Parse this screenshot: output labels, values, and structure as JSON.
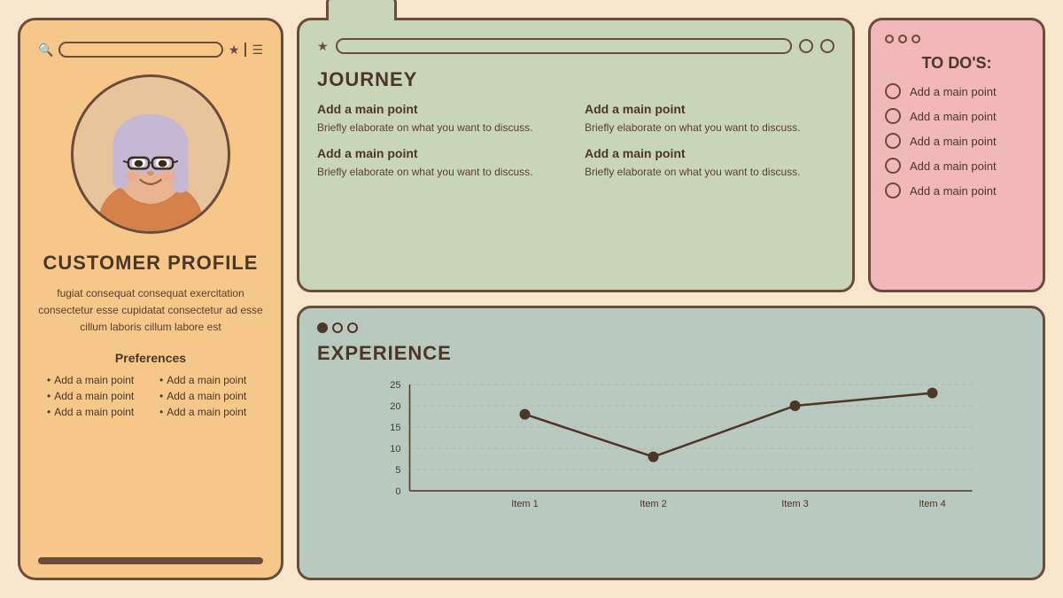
{
  "colors": {
    "background": "#f5e6cc",
    "profile_bg": "#f5c88a",
    "journey_bg": "#c8d5b9",
    "todo_bg": "#f0b8b8",
    "experience_bg": "#b8c9c0",
    "border": "#6b4c3b",
    "text_dark": "#4a3728"
  },
  "profile": {
    "title": "CUSTOMER PROFILE",
    "description": "fugiat consequat consequat exercitation consectetur esse cupidatat consectetur ad esse cillum laboris cillum labore est",
    "preferences_title": "Preferences",
    "preferences": [
      "Add a main point",
      "Add a main point",
      "Add a main point",
      "Add a main point",
      "Add a main point",
      "Add a main point"
    ]
  },
  "journey": {
    "title": "JOURNEY",
    "items": [
      {
        "title": "Add a main point",
        "description": "Briefly elaborate on what you want to discuss."
      },
      {
        "title": "Add a main point",
        "description": "Briefly elaborate on what you want to discuss."
      },
      {
        "title": "Add a main point",
        "description": "Briefly elaborate on what you want to discuss."
      },
      {
        "title": "Add a main point",
        "description": "Briefly elaborate on what you want to discuss."
      }
    ]
  },
  "todo": {
    "title": "TO DO'S:",
    "items": [
      "Add a main point",
      "Add a main point",
      "Add a main point",
      "Add a main point",
      "Add a main point"
    ]
  },
  "experience": {
    "title": "EXPERIENCE",
    "chart": {
      "y_labels": [
        "0",
        "5",
        "10",
        "15",
        "20",
        "25"
      ],
      "x_labels": [
        "Item 1",
        "Item 2",
        "Item 3",
        "Item 4"
      ],
      "data_points": [
        18,
        8,
        20,
        23
      ]
    }
  }
}
